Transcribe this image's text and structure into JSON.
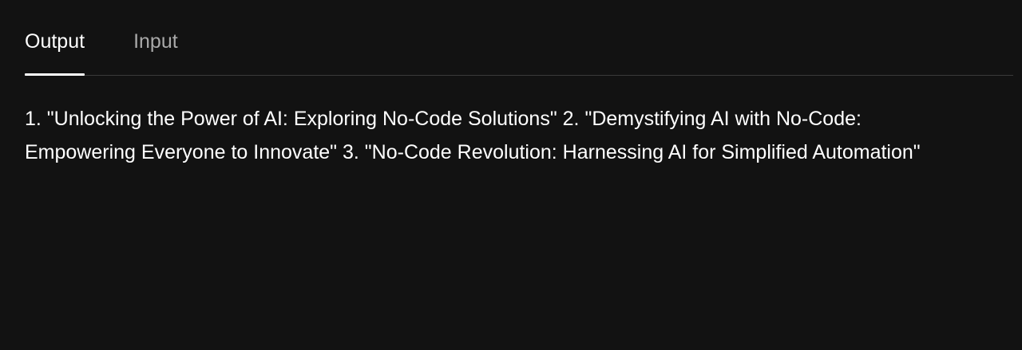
{
  "tabs": [
    {
      "label": "Output",
      "active": true
    },
    {
      "label": "Input",
      "active": false
    }
  ],
  "output": {
    "text": "1. \"Unlocking the Power of AI: Exploring No-Code Solutions\" 2. \"Demystifying AI with No-Code: Empowering Everyone to Innovate\" 3. \"No-Code Revolution: Harnessing AI for Simplified Automation\""
  },
  "colors": {
    "background": "#121212",
    "active_tab": "#ffffff",
    "inactive_tab": "#a9a9a9",
    "divider": "#3a3a3a"
  }
}
